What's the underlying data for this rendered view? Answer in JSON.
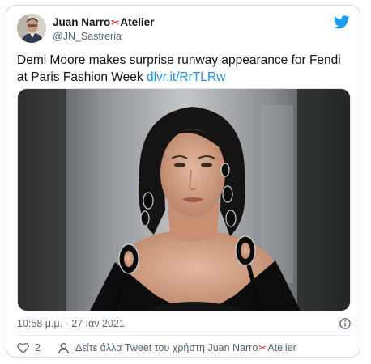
{
  "tweet": {
    "author": {
      "name": "Juan Narro",
      "scissors": "✂",
      "name_suffix": "Atelier",
      "handle": "@JN_Sastreria"
    },
    "text": "Demi Moore makes surprise runway appearance for Fendi at Paris Fashion Week",
    "link": "dlvr.it/RrTLRw",
    "timestamp": "10:58 μ.μ. · 27 Ιαν 2021",
    "like_count": "2",
    "more_tweets_prefix": "Δείτε άλλα Tweet του χρήστη Juan Narro",
    "more_tweets_suffix": "Atelier"
  },
  "colors": {
    "twitter_blue": "#1d9bf0",
    "link": "#1b95e0",
    "muted_text": "#536471",
    "border": "#cfd9de",
    "scissors_red": "#d23b3b"
  },
  "icons": {
    "brand": "twitter-bird-icon",
    "like": "heart-icon",
    "info": "info-icon",
    "profile": "person-icon"
  }
}
